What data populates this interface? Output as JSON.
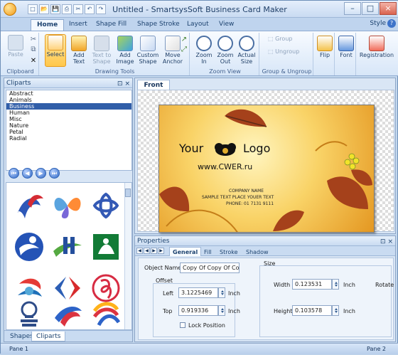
{
  "window": {
    "title": "Untitled - SmartsysSoft Business Card Maker",
    "minimize": "–",
    "maximize": "□",
    "close": "×"
  },
  "qat": [
    "new",
    "open",
    "save",
    "print",
    "cut",
    "undo",
    "redo"
  ],
  "ribbon": {
    "tabs": [
      "Home",
      "Insert",
      "Shape Fill",
      "Shape Stroke",
      "Layout",
      "View"
    ],
    "style": "Style",
    "help": "?",
    "groups": {
      "clipboard": "Clipboard",
      "drawing": "Drawing Tools",
      "zoom": "Zoom View",
      "group": "Group & Ungroup"
    },
    "buttons": {
      "paste": "Paste",
      "cut": "✂",
      "copy": "⧉",
      "delete": "✕",
      "select": "Select",
      "add_text": "Add Text",
      "text_to_shape": "Text to Shape",
      "add_image": "Add Image",
      "custom_shape": "Custom Shape",
      "move_anchor": "Move Anchor",
      "zoom_in": "Zoom In",
      "zoom_out": "Zoom Out",
      "actual_size": "Actual Size",
      "group": "Group",
      "ungroup": "Ungroup",
      "flip": "Flip",
      "font": "Font",
      "registration": "Registration"
    }
  },
  "cliparts": {
    "title": "Cliparts",
    "items": [
      "Abstract",
      "Animals",
      "Business",
      "Human",
      "Misc",
      "Nature",
      "Petal",
      "Radial"
    ],
    "selected": "Business",
    "nav": [
      "⏮",
      "◀",
      "▶",
      "⏭"
    ],
    "bottom_tabs": [
      "Shapes",
      "Cliparts"
    ]
  },
  "document": {
    "tab": "Front"
  },
  "card": {
    "logo_your": "Your",
    "logo_text": "Logo",
    "url": "www.CWER.ru",
    "company": "COMPANY NAME",
    "sample": "SAMPLE TEXT PLACE YOUER TEXT",
    "phone": "PHONE: 01 7131 9111"
  },
  "properties": {
    "title": "Properties",
    "tabs": [
      "General",
      "Fill",
      "Stroke",
      "Shadow"
    ],
    "object_name_label": "Object Name",
    "object_name_value": "Copy Of Copy Of Copy",
    "offset_label": "Offset",
    "left_label": "Left",
    "left_value": "3.1225469",
    "left_unit": "Inch",
    "top_label": "Top",
    "top_value": "0.919336",
    "top_unit": "Inch",
    "lock_label": "Lock Position",
    "size_label": "Size",
    "width_label": "Width",
    "width_value": "0.123531",
    "width_unit": "Inch",
    "height_label": "Height",
    "height_value": "0.103578",
    "height_unit": "Inch",
    "rotate_label": "Rotate"
  },
  "status": {
    "left": "Pane 1",
    "right": "Pane 2"
  }
}
